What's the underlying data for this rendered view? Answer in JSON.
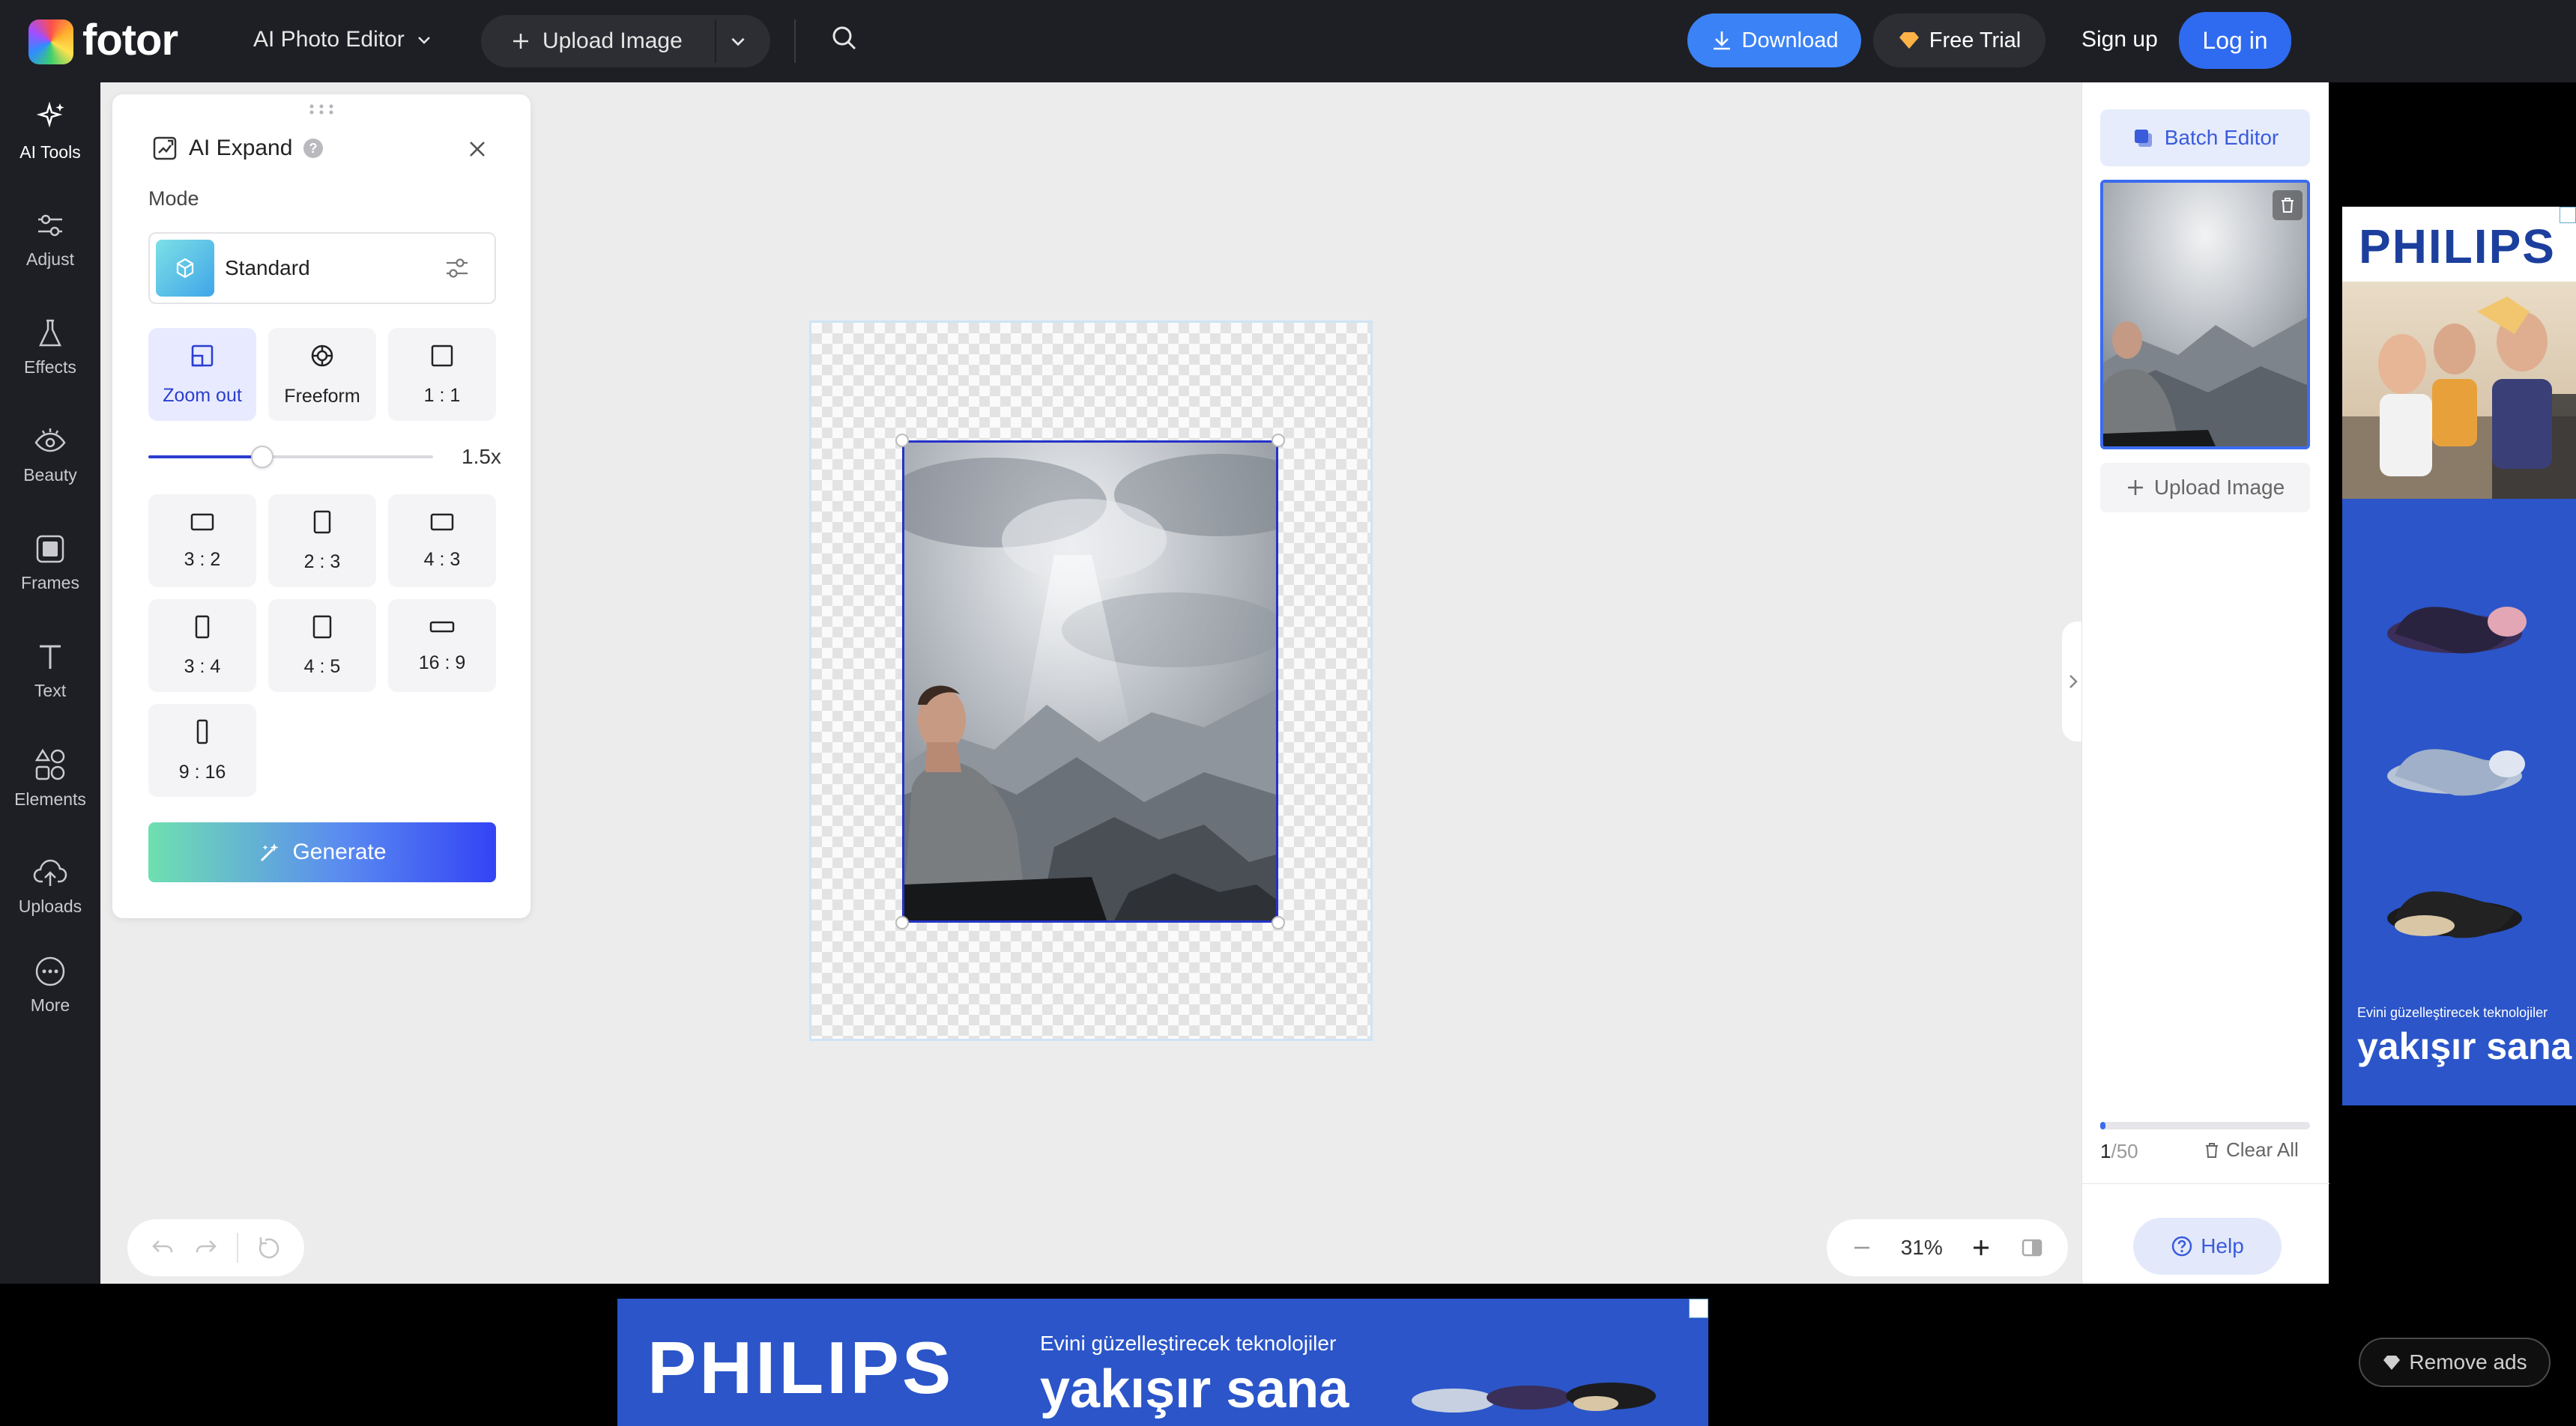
{
  "brand": {
    "name": "fotor"
  },
  "topbar": {
    "editor_label": "AI Photo Editor",
    "upload_label": "Upload Image",
    "download_label": "Download",
    "free_trial_label": "Free Trial",
    "signup_label": "Sign up",
    "login_label": "Log in"
  },
  "rail": {
    "items": [
      {
        "label": "AI Tools",
        "icon": "sparkle-icon"
      },
      {
        "label": "Adjust",
        "icon": "sliders-icon"
      },
      {
        "label": "Effects",
        "icon": "flask-icon"
      },
      {
        "label": "Beauty",
        "icon": "eye-icon"
      },
      {
        "label": "Frames",
        "icon": "frame-icon"
      },
      {
        "label": "Text",
        "icon": "text-icon"
      },
      {
        "label": "Elements",
        "icon": "shapes-icon"
      },
      {
        "label": "Uploads",
        "icon": "cloud-upload-icon"
      },
      {
        "label": "More",
        "icon": "more-icon"
      }
    ]
  },
  "panel": {
    "title": "AI Expand",
    "mode_label": "Mode",
    "mode_value": "Standard",
    "options": [
      {
        "label": "Zoom out"
      },
      {
        "label": "Freeform"
      },
      {
        "label": "1 : 1"
      }
    ],
    "zoom_value": "1.5x",
    "zoom_fraction": 0.4,
    "ratios": [
      "3 : 2",
      "2 : 3",
      "4 : 3",
      "3 : 4",
      "4 : 5",
      "16 : 9",
      "9 : 16"
    ],
    "generate_label": "Generate"
  },
  "right": {
    "batch_label": "Batch Editor",
    "upload_label": "Upload Image",
    "count_current": "1",
    "count_total": "/50",
    "clear_label": "Clear All",
    "help_label": "Help"
  },
  "zoom": {
    "value": "31%"
  },
  "ads": {
    "brand": "PHILIPS",
    "tagline_small": "Evini güzelleştirecek teknolojiler",
    "tagline_big": "yakışır sana",
    "remove_label": "Remove ads"
  },
  "colors": {
    "accent": "#2f6bf0",
    "topbar": "#1e1f24",
    "ad_blue": "#2b55c9"
  }
}
